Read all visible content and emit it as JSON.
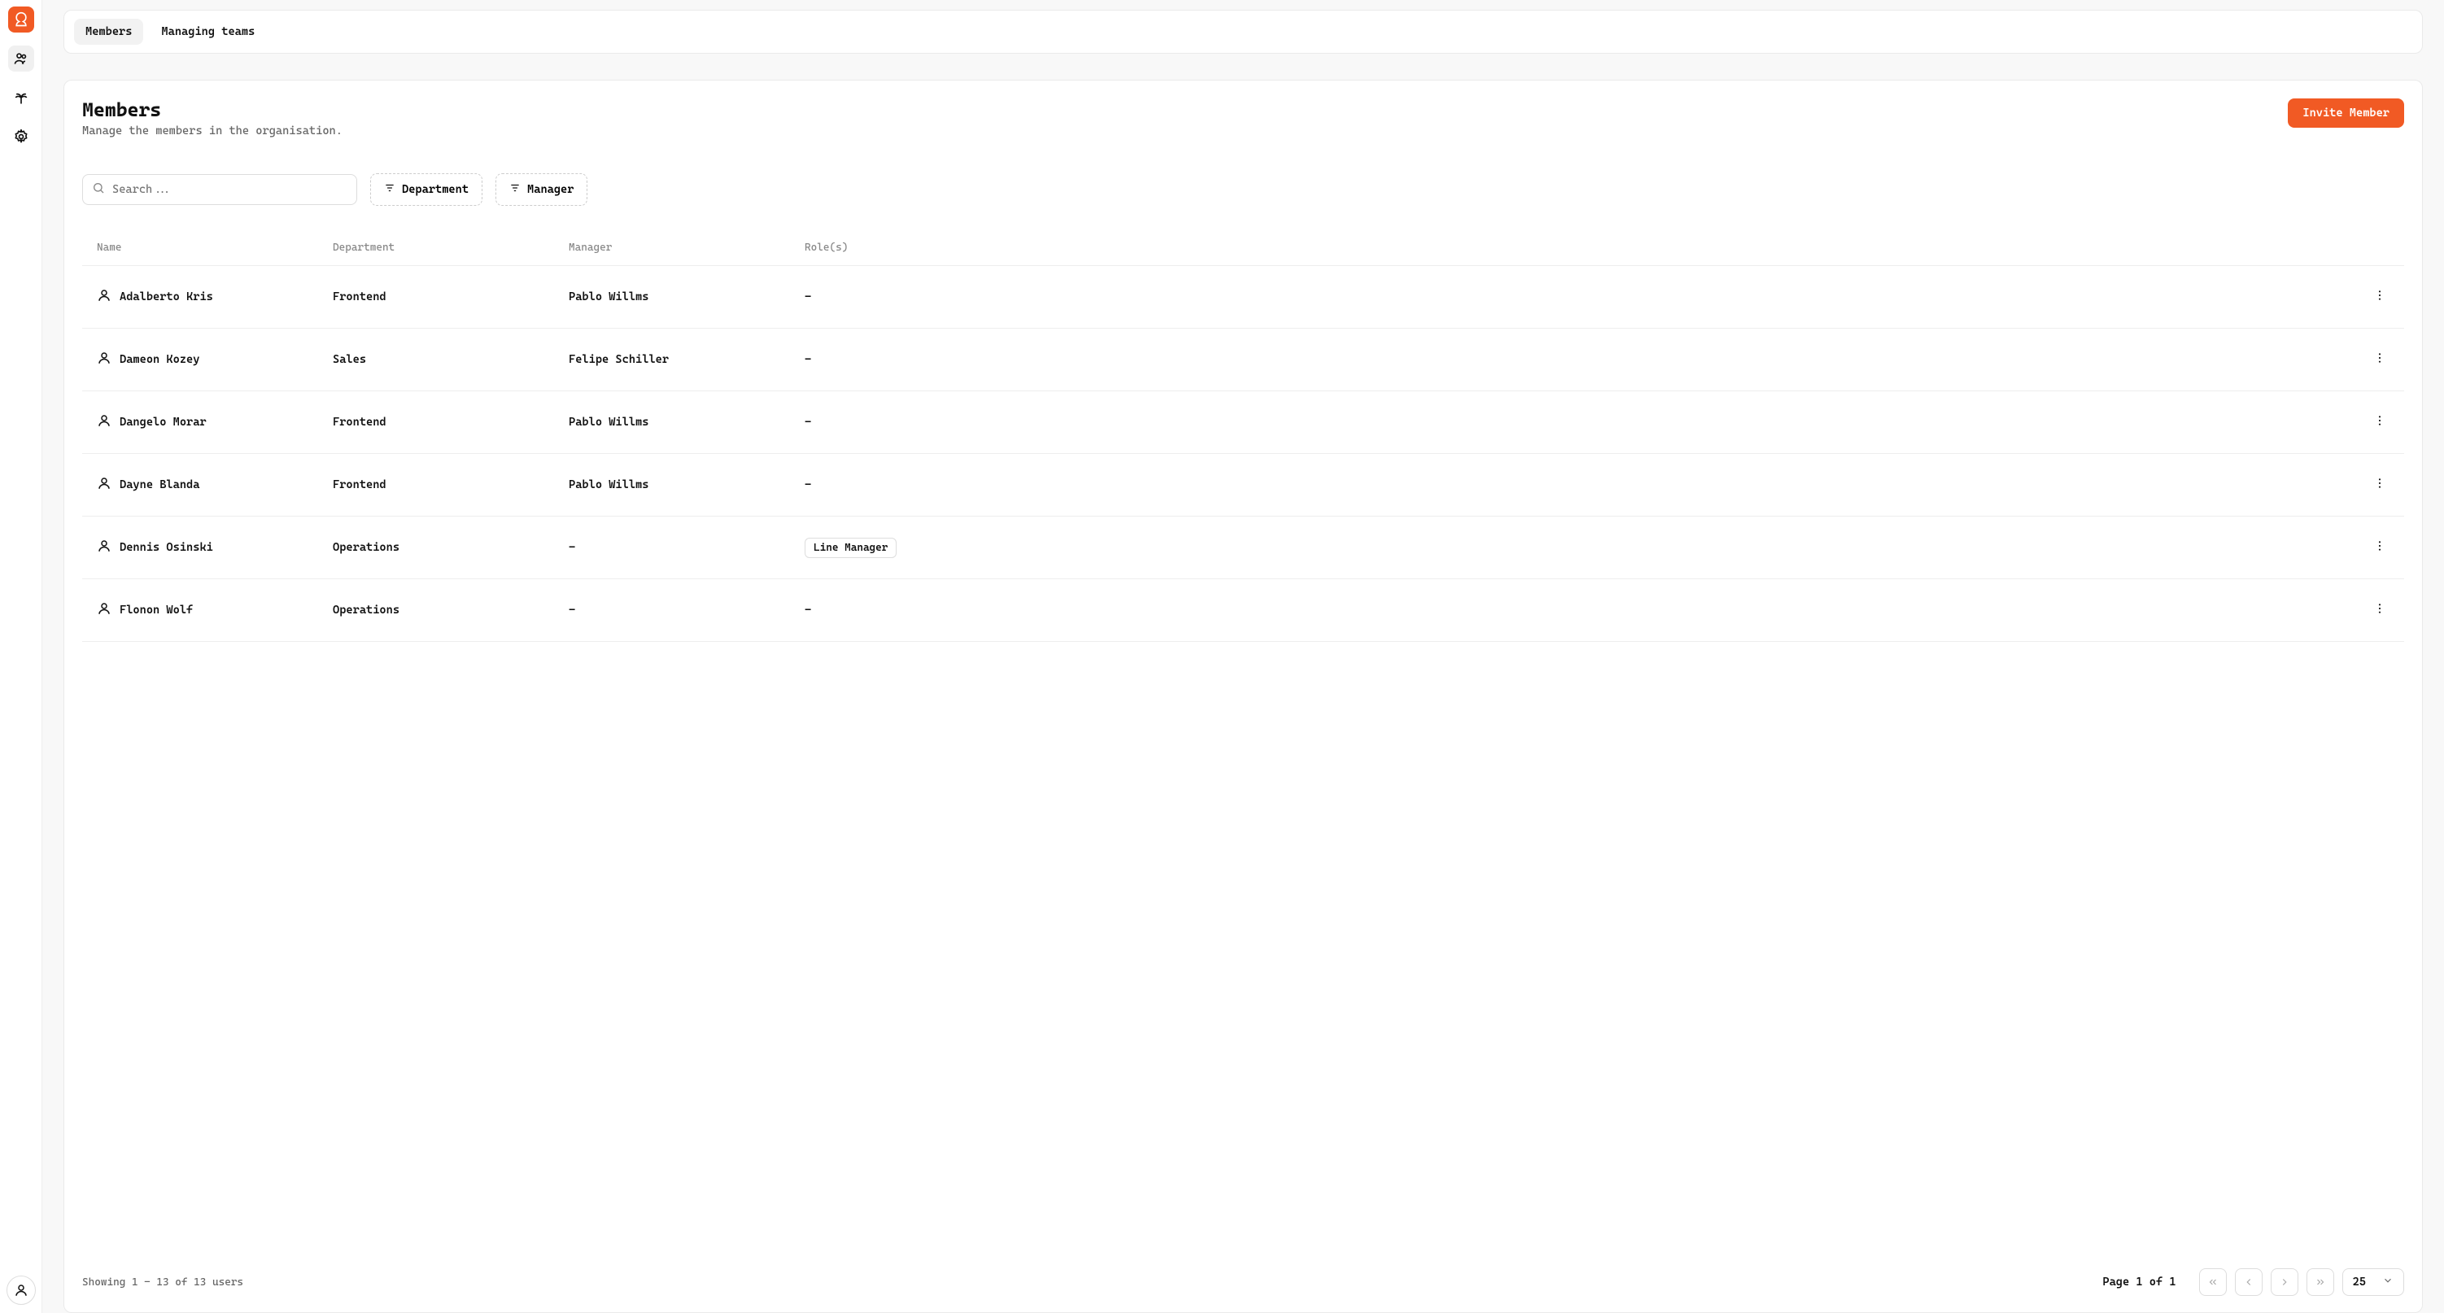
{
  "tabs": {
    "members": "Members",
    "teams": "Managing teams"
  },
  "header": {
    "title": "Members",
    "subtitle": "Manage the members in the organisation.",
    "invite_label": "Invite Member"
  },
  "filters": {
    "search_placeholder": "Search...",
    "department_label": "Department",
    "manager_label": "Manager"
  },
  "columns": {
    "name": "Name",
    "department": "Department",
    "manager": "Manager",
    "roles": "Role(s)"
  },
  "rows": [
    {
      "name": "Adalberto Kris",
      "department": "Frontend",
      "manager": "Pablo Willms",
      "roles": "-"
    },
    {
      "name": "Dameon Kozey",
      "department": "Sales",
      "manager": "Felipe Schiller",
      "roles": "-"
    },
    {
      "name": "Dangelo Morar",
      "department": "Frontend",
      "manager": "Pablo Willms",
      "roles": "-"
    },
    {
      "name": "Dayne Blanda",
      "department": "Frontend",
      "manager": "Pablo Willms",
      "roles": "-"
    },
    {
      "name": "Dennis Osinski",
      "department": "Operations",
      "manager": "-",
      "roles": "Line Manager"
    },
    {
      "name": "Flonon Wolf",
      "department": "Operations",
      "manager": "-",
      "roles": "-"
    }
  ],
  "footer": {
    "showing": "Showing 1 - 13 of 13 users",
    "page_label": "Page 1 of 1",
    "page_size": "25"
  }
}
